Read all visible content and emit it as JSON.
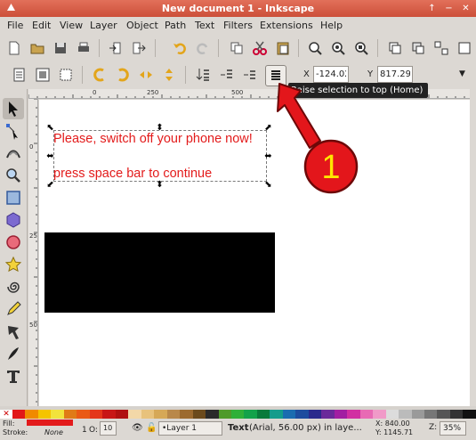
{
  "window": {
    "title": "New document 1 - Inkscape",
    "buttons": [
      "↑",
      "−",
      "✕"
    ]
  },
  "menu": [
    "File",
    "Edit",
    "View",
    "Layer",
    "Object",
    "Path",
    "Text",
    "Filters",
    "Extensions",
    "Help"
  ],
  "controls": {
    "x_label": "X",
    "x_value": "-124.02",
    "y_label": "Y",
    "y_value": "817.293"
  },
  "tooltip": "Raise selection to top (Home)",
  "ruler": {
    "h_labels": [
      "0",
      "250",
      "500"
    ],
    "v_labels": [
      "0",
      "250",
      "500"
    ]
  },
  "canvas": {
    "text_line1": "Please, switch off your phone now!",
    "text_line2": "press space bar to continue",
    "text_color": "#e31b1b",
    "rect_color": "#000000"
  },
  "callout": {
    "number": "1",
    "color": "#e3161b",
    "number_color": "#ffe600"
  },
  "palette": [
    "#e21818",
    "#f08a00",
    "#f5c400",
    "#f2e33c",
    "#e07b16",
    "#ea5a14",
    "#e4361a",
    "#c81616",
    "#b01010",
    "#f3d8a8",
    "#e8c27c",
    "#d6a857",
    "#b9884a",
    "#9c6a2f",
    "#6b4a1c",
    "#2a2a2a",
    "#4f9a2a",
    "#2fb038",
    "#13a24a",
    "#0a7a3a",
    "#149c8c",
    "#1a6cb0",
    "#1d4c9e",
    "#2a2a8c",
    "#6a2a9a",
    "#a21fa2",
    "#d12fa2",
    "#e86ab4",
    "#f09ac8",
    "#dcdcdc",
    "#bbbbbb",
    "#9a9a9a",
    "#777777",
    "#555555",
    "#333333",
    "#111111"
  ],
  "status": {
    "fill_label": "Fill:",
    "fill_value": "",
    "stroke_label": "Stroke:",
    "stroke_value": "None",
    "stroke_width": "1",
    "opacity_label": "O:",
    "opacity_value": "10",
    "layer": "•Layer 1",
    "message_bold": "Text",
    "message_rest": " (Arial, 56.00 px) in laye...",
    "x_coord": "X:  840.00",
    "y_coord": "Y: 1145.71",
    "zoom_label": "Z:",
    "zoom_value": "35%"
  }
}
